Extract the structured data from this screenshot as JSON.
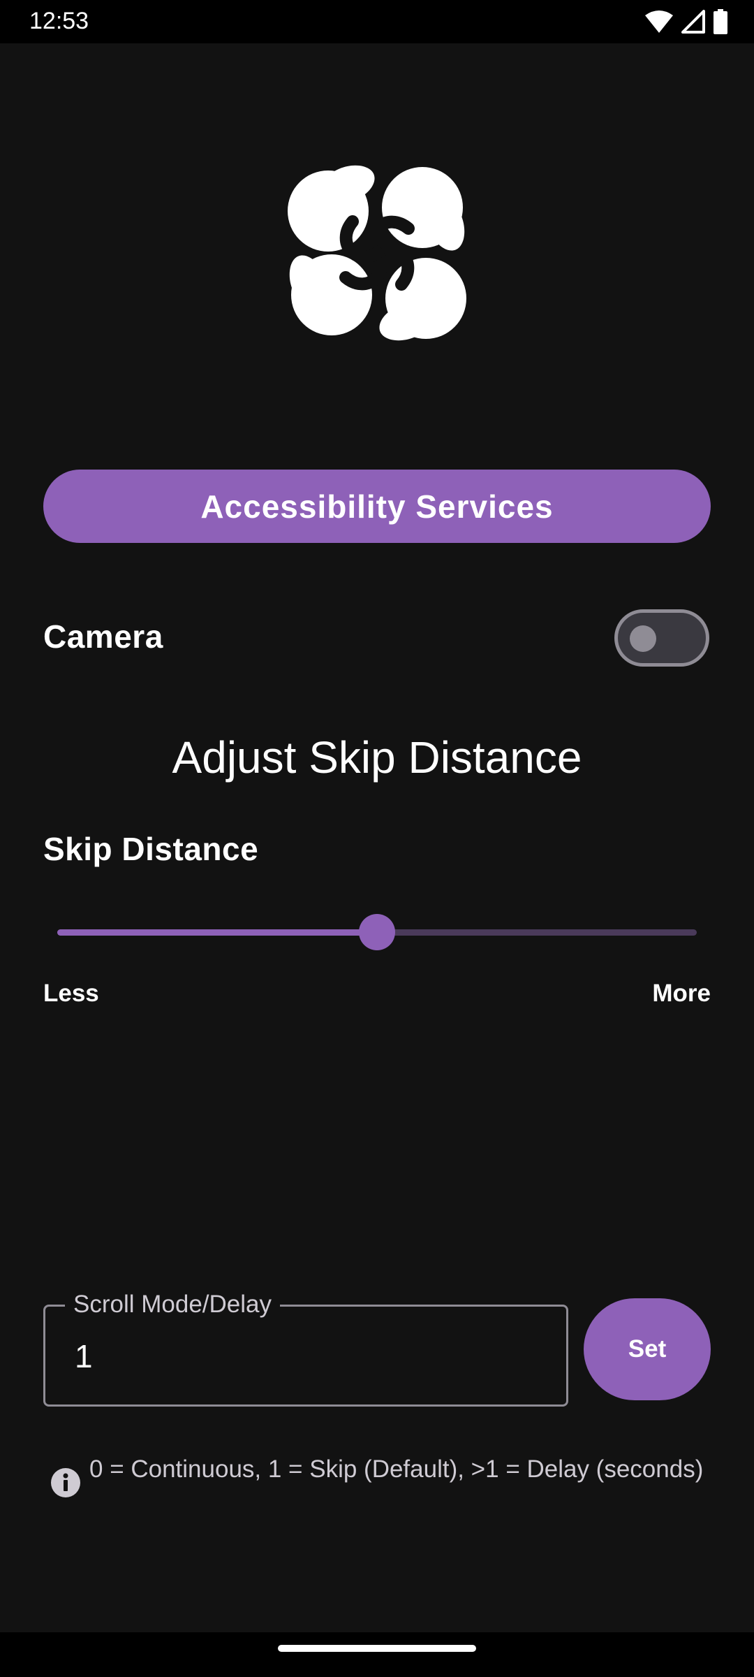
{
  "status_bar": {
    "time": "12:53",
    "icons": [
      "wifi-icon",
      "cellular-signal-icon",
      "battery-icon"
    ]
  },
  "app_icon": "pinwheel-logo-icon",
  "accessibility_button": {
    "label": "Accessibility Services"
  },
  "camera": {
    "label": "Camera",
    "enabled": false
  },
  "section_title": "Adjust Skip Distance",
  "skip_slider": {
    "label": "Skip Distance",
    "value_fraction": 0.5,
    "min_label": "Less",
    "max_label": "More"
  },
  "scroll_field": {
    "label": "Scroll Mode/Delay",
    "value": "1"
  },
  "set_button": {
    "label": "Set"
  },
  "info": {
    "icon": "info-icon",
    "text": "0 = Continuous, 1 = Skip (Default), >1 = Delay (seconds)"
  },
  "colors": {
    "accent": "#8e61b8",
    "background": "#121212"
  }
}
